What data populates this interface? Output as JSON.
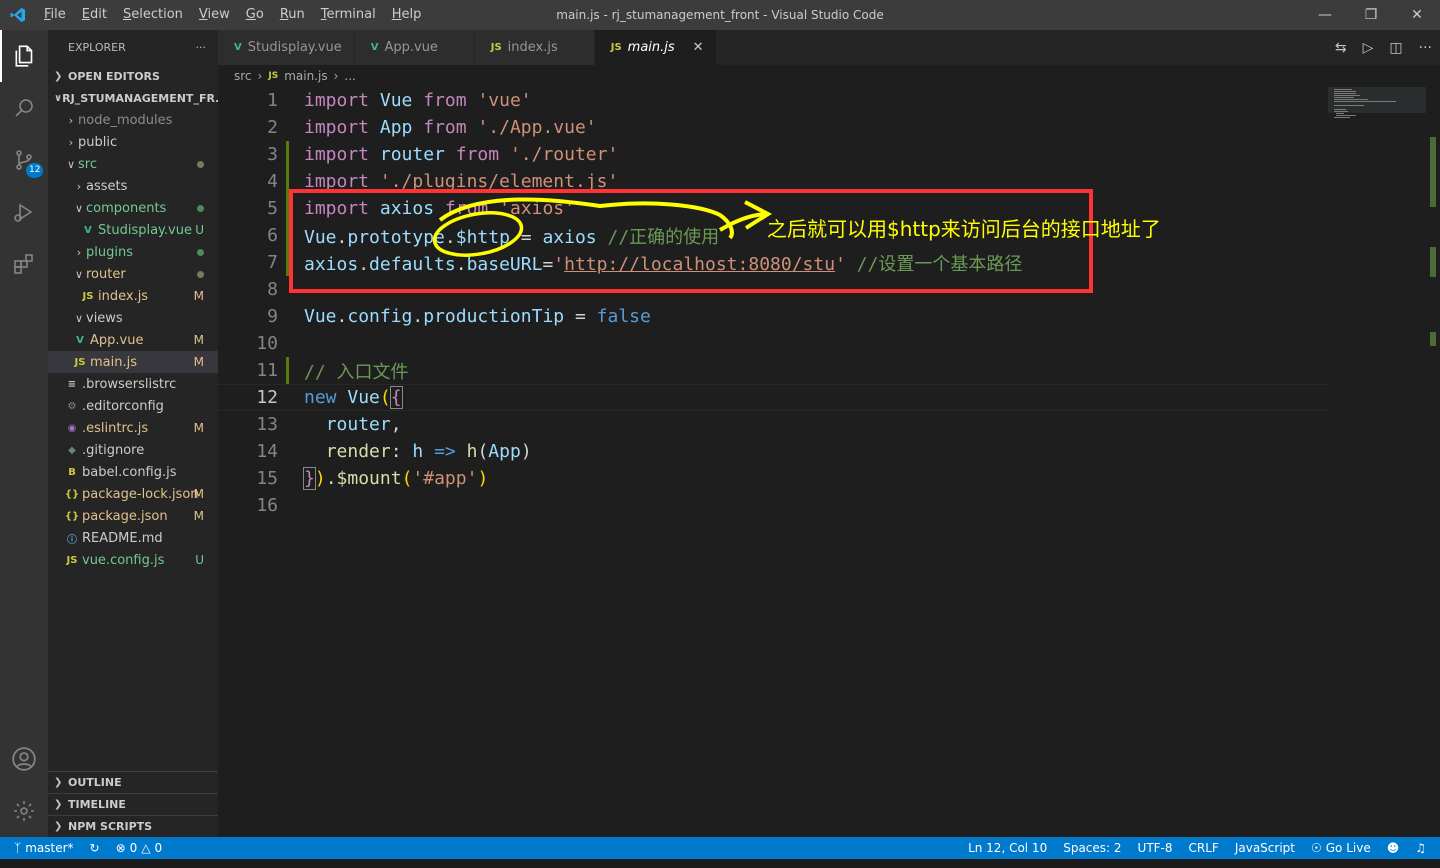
{
  "titlebar": {
    "menu": [
      "File",
      "Edit",
      "Selection",
      "View",
      "Go",
      "Run",
      "Terminal",
      "Help"
    ],
    "title": "main.js - rj_stumanagement_front - Visual Studio Code"
  },
  "activity": {
    "scm_badge": "12"
  },
  "sidebar": {
    "header": "EXPLORER",
    "open_editors": "OPEN EDITORS",
    "project": "RJ_STUMANAGEMENT_FR...",
    "tree": [
      {
        "label": "node_modules",
        "deco": ""
      },
      {
        "label": "public",
        "deco": ""
      },
      {
        "label": "src",
        "deco": ""
      },
      {
        "label": "assets",
        "deco": ""
      },
      {
        "label": "components",
        "deco": ""
      },
      {
        "label": "Studisplay.vue",
        "deco": "U"
      },
      {
        "label": "plugins",
        "deco": ""
      },
      {
        "label": "router",
        "deco": ""
      },
      {
        "label": "index.js",
        "deco": "M"
      },
      {
        "label": "views",
        "deco": ""
      },
      {
        "label": "App.vue",
        "deco": "M"
      },
      {
        "label": "main.js",
        "deco": "M"
      },
      {
        "label": ".browserslistrc",
        "deco": ""
      },
      {
        "label": ".editorconfig",
        "deco": ""
      },
      {
        "label": ".eslintrc.js",
        "deco": "M"
      },
      {
        "label": ".gitignore",
        "deco": ""
      },
      {
        "label": "babel.config.js",
        "deco": ""
      },
      {
        "label": "package-lock.json",
        "deco": "M"
      },
      {
        "label": "package.json",
        "deco": "M"
      },
      {
        "label": "README.md",
        "deco": ""
      },
      {
        "label": "vue.config.js",
        "deco": "U"
      }
    ],
    "outline": "OUTLINE",
    "timeline": "TIMELINE",
    "npm": "NPM SCRIPTS"
  },
  "tabs": [
    {
      "label": "Studisplay.vue",
      "icon": "V"
    },
    {
      "label": "App.vue",
      "icon": "V"
    },
    {
      "label": "index.js",
      "icon": "JS"
    },
    {
      "label": "main.js",
      "icon": "JS"
    }
  ],
  "breadcrumb": {
    "folder": "src",
    "file": "main.js",
    "more": "..."
  },
  "editor": {
    "line_numbers": [
      "1",
      "2",
      "3",
      "4",
      "5",
      "6",
      "7",
      "8",
      "9",
      "10",
      "11",
      "12",
      "13",
      "14",
      "15",
      "16"
    ],
    "l1": {
      "a": "import",
      "b": "Vue",
      "c": "from",
      "d": "'vue'"
    },
    "l2": {
      "a": "import",
      "b": "App",
      "c": "from",
      "d": "'./App.vue'"
    },
    "l3": {
      "a": "import",
      "b": "router",
      "c": "from",
      "d": "'./router'"
    },
    "l4": {
      "a": "import",
      "d": "'./plugins/element.js'"
    },
    "l5": {
      "a": "import",
      "b": "axios",
      "c": "from",
      "d": "'axios'"
    },
    "l6": {
      "a": "Vue",
      "b": ".",
      "c": "prototype",
      "d": ".",
      "e": "$http",
      "f": " = ",
      "g": "axios",
      "h": "//正确的使用"
    },
    "l7": {
      "a": "axios",
      "b": ".",
      "c": "defaults",
      "d": ".",
      "e": "baseURL",
      "f": "=",
      "g": "'",
      "url": "http://localhost:8080/stu",
      "i": "'",
      "j": "//设置一个基本路径"
    },
    "l9": {
      "a": "Vue",
      "b": ".",
      "c": "config",
      "d": ".",
      "e": "productionTip",
      "f": " = ",
      "g": "false"
    },
    "l11": "// 入口文件",
    "l12": {
      "a": "new",
      "b": "Vue",
      "c": "(",
      "d": "{"
    },
    "l13": {
      "a": "router",
      "b": ","
    },
    "l14": {
      "a": "render",
      "b": ": ",
      "c": "h",
      "d": " => ",
      "e": "h",
      "f": "(",
      "g": "App",
      "h": ")"
    },
    "l15": {
      "a": "}",
      "b": ")",
      "c": ".",
      "d": "$mount",
      "e": "(",
      "f": "'#app'",
      "g": ")"
    }
  },
  "annotation": "之后就可以用$http来访问后台的接口地址了",
  "statusbar": {
    "branch": "master*",
    "errors": "0",
    "warnings": "0",
    "position": "Ln 12, Col 10",
    "spaces": "Spaces: 2",
    "encoding": "UTF-8",
    "eol": "CRLF",
    "language": "JavaScript",
    "golive": "Go Live"
  },
  "colors": {
    "accent": "#007acc",
    "keyword": "#c586c0",
    "variable": "#9cdcfe",
    "string": "#ce9178",
    "comment": "#6a9955",
    "annotation_box": "#ff3333",
    "annotation_text": "#ffff00"
  }
}
